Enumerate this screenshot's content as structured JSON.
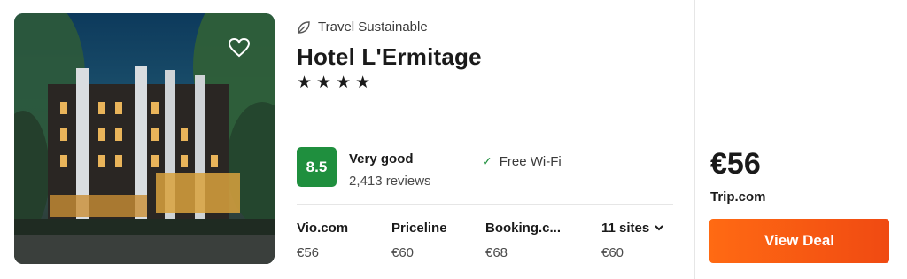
{
  "hotel": {
    "badge": "Travel Sustainable",
    "name": "Hotel L'Ermitage",
    "stars": [
      "★",
      "★",
      "★",
      "★"
    ]
  },
  "rating": {
    "score": "8.5",
    "label": "Very good",
    "reviews": "2,413 reviews"
  },
  "amenities": [
    "Free Wi-Fi"
  ],
  "sites": [
    {
      "name": "Vio.com",
      "price": "€56"
    },
    {
      "name": "Priceline",
      "price": "€60"
    },
    {
      "name": "Booking.c...",
      "price": "€68"
    },
    {
      "name": "11 sites",
      "price": "€60"
    }
  ],
  "deal": {
    "price": "€56",
    "provider": "Trip.com",
    "button_label": "View Deal"
  },
  "colors": {
    "rating_green": "#1f8f3e",
    "deal_orange": "#ff6a13"
  },
  "icons": {
    "badge": "leaf-icon",
    "favorite": "heart-icon",
    "amenity": "check-icon",
    "more_sites": "chevron-down-icon"
  }
}
